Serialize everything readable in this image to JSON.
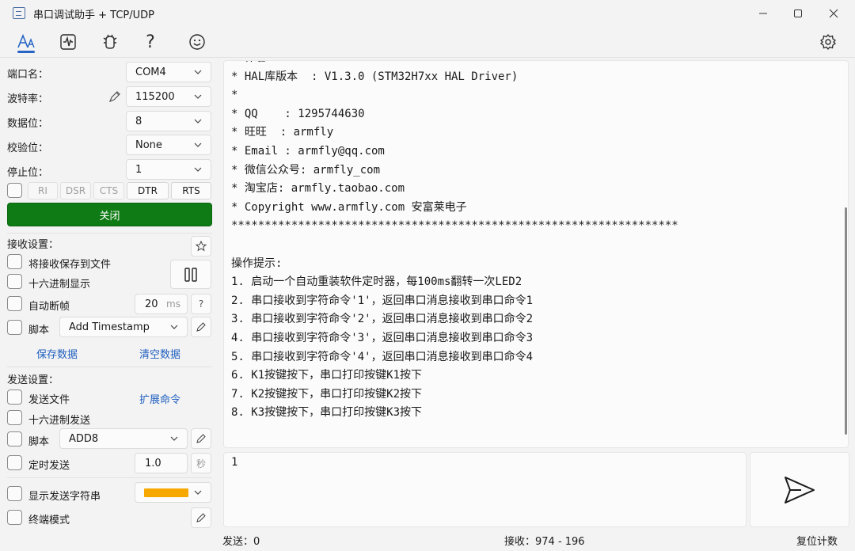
{
  "window": {
    "title": "串口调试助手 + TCP/UDP"
  },
  "serial": {
    "port_label": "端口名：",
    "port_value": "COM4",
    "baud_label": "波特率：",
    "baud_value": "115200",
    "databits_label": "数据位：",
    "databits_value": "8",
    "parity_label": "校验位：",
    "parity_value": "None",
    "stopbits_label": "停止位：",
    "stopbits_value": "1",
    "signals": [
      "RI",
      "DSR",
      "CTS",
      "DTR",
      "RTS"
    ],
    "close_label": "关闭"
  },
  "receive": {
    "section_label": "接收设置：",
    "save_to_file": "将接收保存到文件",
    "hex_display": "十六进制显示",
    "auto_frame": "自动断帧",
    "auto_frame_value": "20",
    "auto_frame_unit": "ms",
    "help": "?",
    "script": "脚本",
    "script_value": "Add Timestamp",
    "save_data": "保存数据",
    "clear_data": "清空数据"
  },
  "send": {
    "section_label": "发送设置：",
    "send_file": "发送文件",
    "extend_cmd": "扩展命令",
    "hex_send": "十六进制发送",
    "script": "脚本",
    "script_value": "ADD8",
    "timed_send": "定时发送",
    "timed_value": "1.0",
    "timed_unit": "秒",
    "show_send_str": "显示发送字符串",
    "show_send_color": "#f7a800",
    "terminal_mode": "终端模式",
    "input_value": "1"
  },
  "receive_lines": [
    "* 作者",
    "* HAL库版本  : V1.3.0 (STM32H7xx HAL Driver)",
    "*",
    "* QQ    : 1295744630",
    "* 旺旺  : armfly",
    "* Email : armfly@qq.com",
    "* 微信公众号: armfly_com",
    "* 淘宝店: armfly.taobao.com",
    "* Copyright www.armfly.com 安富莱电子",
    "*******************************************************************",
    "",
    "操作提示:",
    "1. 启动一个自动重装软件定时器，每100ms翻转一次LED2",
    "2. 串口接收到字符命令'1'，返回串口消息接收到串口命令1",
    "3. 串口接收到字符命令'2'，返回串口消息接收到串口命令2",
    "4. 串口接收到字符命令'3'，返回串口消息接收到串口命令3",
    "5. 串口接收到字符命令'4'，返回串口消息接收到串口命令4",
    "6. K1按键按下，串口打印按键K1按下",
    "7. K2按键按下，串口打印按键K2按下",
    "8. K3按键按下，串口打印按键K3按下"
  ],
  "status": {
    "sent": "发送：0",
    "received": "接收：974 - 196",
    "reset": "复位计数"
  }
}
